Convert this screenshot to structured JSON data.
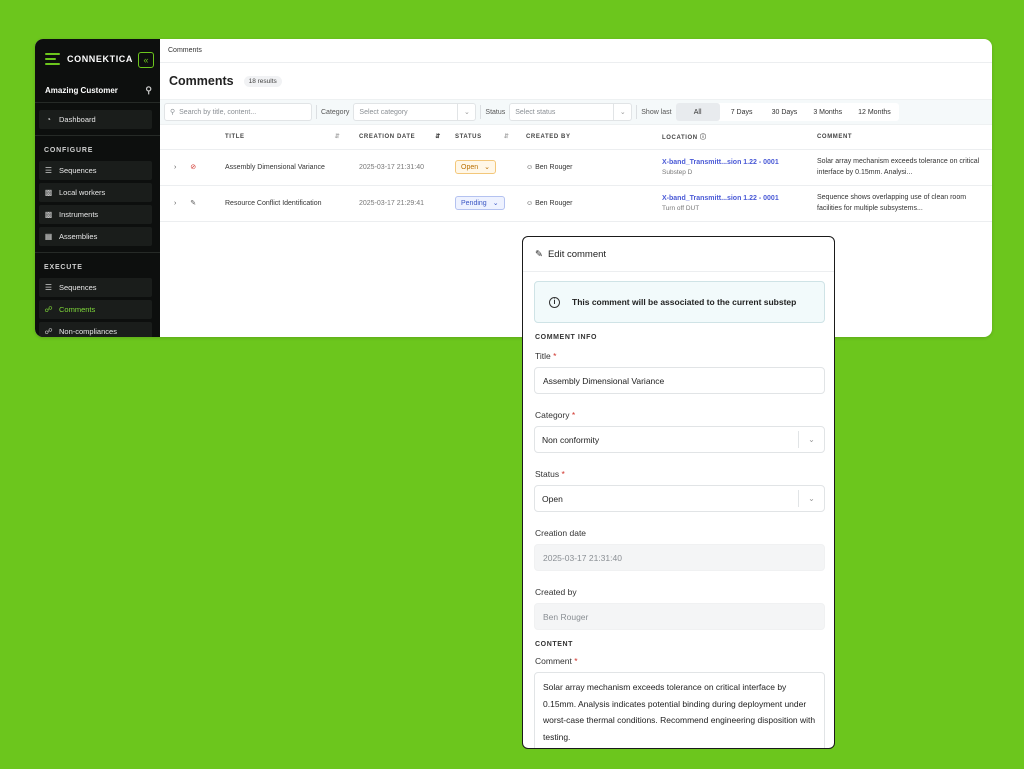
{
  "sidebar": {
    "brand": "CONNEKTICA",
    "collapse_icon": "«",
    "customer": "Amazing Customer",
    "dashboard": "Dashboard",
    "configure_title": "CONFIGURE",
    "configure_items": [
      "Sequences",
      "Local workers",
      "Instruments",
      "Assemblies"
    ],
    "execute_title": "EXECUTE",
    "execute_items": [
      "Sequences",
      "Comments",
      "Non-compliances"
    ],
    "accent": "#7fd93a"
  },
  "breadcrumb": "Comments",
  "page": {
    "title": "Comments",
    "count": "18 results"
  },
  "filters": {
    "search_placeholder": "Search by title, content...",
    "category_label": "Category",
    "category_placeholder": "Select category",
    "status_label": "Status",
    "status_placeholder": "Select status",
    "show_last_label": "Show last",
    "ranges": [
      "All",
      "7 Days",
      "30 Days",
      "3 Months",
      "12 Months"
    ],
    "selected_range": "All"
  },
  "table": {
    "headers": [
      "TITLE",
      "CREATION DATE",
      "STATUS",
      "CREATED BY",
      "LOCATION",
      "COMMENT"
    ],
    "rows": [
      {
        "title": "Assembly Dimensional Variance",
        "date": "2025-03-17 21:31:40",
        "status": "Open",
        "created_by": "Ben Rouger",
        "location": "X-band_Transmitt...sion 1.22 - 0001",
        "location_sub": "Substep D",
        "comment": "Solar array mechanism exceeds tolerance on critical interface by 0.15mm. Analysi..."
      },
      {
        "title": "Resource Conflict Identification",
        "date": "2025-03-17 21:29:41",
        "status": "Pending",
        "created_by": "Ben Rouger",
        "location": "X-band_Transmitt...sion 1.22 - 0001",
        "location_sub": "Turn off DUT",
        "comment": "Sequence shows overlapping use of clean room facilities for multiple subsystems..."
      }
    ]
  },
  "edit": {
    "title": "Edit comment",
    "notice": "This comment will be associated to the current substep",
    "section_info": "COMMENT INFO",
    "title_label": "Title",
    "title_value": "Assembly Dimensional Variance",
    "category_label": "Category",
    "category_value": "Non conformity",
    "status_label": "Status",
    "status_value": "Open",
    "creation_label": "Creation date",
    "creation_value": "2025-03-17 21:31:40",
    "created_by_label": "Created by",
    "created_by_value": "Ben Rouger",
    "section_content": "CONTENT",
    "comment_label": "Comment",
    "comment_value": "Solar array mechanism exceeds tolerance on critical interface by 0.15mm. Analysis indicates potential binding during deployment under worst-case thermal conditions. Recommend engineering disposition with testing.",
    "required_mark": "*"
  }
}
